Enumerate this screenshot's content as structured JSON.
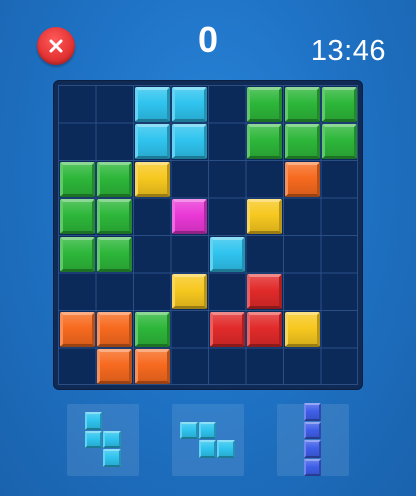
{
  "hud": {
    "score": "0",
    "timer": "13:46",
    "close_icon": "close-icon"
  },
  "colors": {
    "cyan": "#2fc4ef",
    "green": "#2db73a",
    "yellow": "#f7c81f",
    "orange": "#f76a1f",
    "magenta": "#ea38d6",
    "red": "#e22a2a",
    "blue": "#3f5fe8",
    "board_bg": "#0b2a5a",
    "grid_line": "#2b4f85"
  },
  "board": {
    "rows": 8,
    "cols": 8,
    "cells": [
      [
        null,
        null,
        "cyan",
        "cyan",
        null,
        "green",
        "green",
        "green"
      ],
      [
        null,
        null,
        "cyan",
        "cyan",
        null,
        "green",
        "green",
        "green"
      ],
      [
        "green",
        "green",
        "yellow",
        null,
        null,
        null,
        "orange",
        null
      ],
      [
        "green",
        "green",
        null,
        "magenta",
        null,
        "yellow",
        null,
        null
      ],
      [
        "green",
        "green",
        null,
        null,
        "cyan",
        null,
        null,
        null
      ],
      [
        null,
        null,
        null,
        "yellow",
        null,
        "red",
        null,
        null
      ],
      [
        "orange",
        "orange",
        "green",
        null,
        "red",
        "red",
        "yellow",
        null
      ],
      [
        null,
        "orange",
        "orange",
        null,
        null,
        null,
        null,
        null
      ]
    ]
  },
  "tray": [
    {
      "name": "s-piece-vertical",
      "color": "cyan",
      "cells": [
        [
          0,
          0
        ],
        [
          1,
          0
        ],
        [
          1,
          1
        ],
        [
          2,
          1
        ]
      ]
    },
    {
      "name": "z-piece-horizontal",
      "color": "cyan",
      "cells": [
        [
          0,
          0
        ],
        [
          0,
          1
        ],
        [
          1,
          1
        ],
        [
          1,
          2
        ]
      ]
    },
    {
      "name": "i-piece-vertical",
      "color": "blue",
      "cells": [
        [
          0,
          0
        ],
        [
          1,
          0
        ],
        [
          2,
          0
        ],
        [
          3,
          0
        ]
      ]
    }
  ]
}
